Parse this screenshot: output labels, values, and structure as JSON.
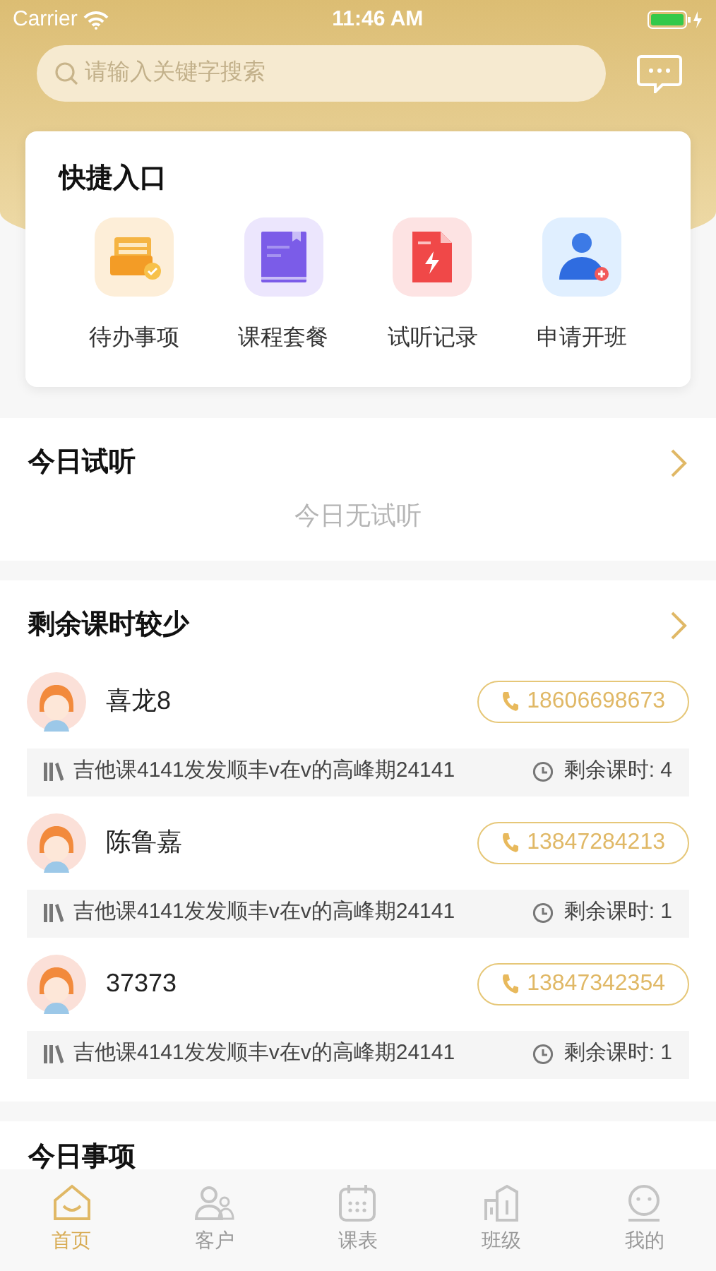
{
  "status_bar": {
    "carrier": "Carrier",
    "time": "11:46 AM"
  },
  "search": {
    "placeholder": "请输入关键字搜索"
  },
  "quick_entry": {
    "title": "快捷入口",
    "items": [
      {
        "label": "待办事项",
        "kind": "todo"
      },
      {
        "label": "课程套餐",
        "kind": "book"
      },
      {
        "label": "试听记录",
        "kind": "record"
      },
      {
        "label": "申请开班",
        "kind": "apply"
      }
    ]
  },
  "today_trial": {
    "title": "今日试听",
    "empty": "今日无试听"
  },
  "low_hours": {
    "title": "剩余课时较少",
    "students": [
      {
        "name": "喜龙8",
        "phone": "18606698673",
        "course": "吉他课4141发发顺丰v在v的高峰期24141",
        "remaining": "剩余课时: 4"
      },
      {
        "name": "陈鲁嘉",
        "phone": "13847284213",
        "course": "吉他课4141发发顺丰v在v的高峰期24141",
        "remaining": "剩余课时: 1"
      },
      {
        "name": "37373",
        "phone": "13847342354",
        "course": "吉他课4141发发顺丰v在v的高峰期24141",
        "remaining": "剩余课时: 1"
      }
    ]
  },
  "today_tasks": {
    "title": "今日事项"
  },
  "tab_bar": [
    {
      "label": "首页",
      "kind": "home",
      "selected": true
    },
    {
      "label": "客户",
      "kind": "clients",
      "selected": false
    },
    {
      "label": "课表",
      "kind": "calendar",
      "selected": false
    },
    {
      "label": "班级",
      "kind": "class",
      "selected": false
    },
    {
      "label": "我的",
      "kind": "me",
      "selected": false
    }
  ]
}
